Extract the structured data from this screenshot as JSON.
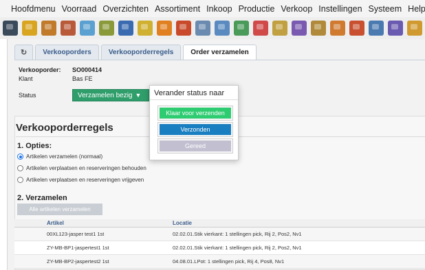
{
  "menu": {
    "home_icon": "home-icon",
    "items": [
      "Hoofdmenu",
      "Voorraad",
      "Overzichten",
      "Assortiment",
      "Inkoop",
      "Productie",
      "Verkoop",
      "Instellingen",
      "Systeem",
      "Help"
    ]
  },
  "toolbar": {
    "icons": [
      {
        "name": "device-icon",
        "color": "#3a4a5a"
      },
      {
        "name": "folder-icon",
        "color": "#d9a520"
      },
      {
        "name": "tools-icon",
        "color": "#c07a2a"
      },
      {
        "name": "wrench-icon",
        "color": "#b85a3a"
      },
      {
        "name": "box-icon",
        "color": "#5aa0d0"
      },
      {
        "name": "grid-icon",
        "color": "#8a9a3a"
      },
      {
        "name": "sphere-icon",
        "color": "#3a6ab0"
      },
      {
        "name": "bowl-icon",
        "color": "#d0b030"
      },
      {
        "name": "gem-icon",
        "color": "#e08020"
      },
      {
        "name": "puzzle-icon",
        "color": "#c84a2a"
      },
      {
        "name": "search-icon",
        "color": "#6a8ab0"
      },
      {
        "name": "magnifier-icon",
        "color": "#5a8ac0"
      },
      {
        "name": "globe-icon",
        "color": "#4a9a5a"
      },
      {
        "name": "pencil-icon",
        "color": "#d04a4a"
      },
      {
        "name": "clipboard-icon",
        "color": "#c0a040"
      },
      {
        "name": "package-icon",
        "color": "#7a5ab0"
      },
      {
        "name": "notepad-icon",
        "color": "#b08a3a"
      },
      {
        "name": "user-icon",
        "color": "#d07a30"
      },
      {
        "name": "note-icon",
        "color": "#c85030"
      },
      {
        "name": "cube-icon",
        "color": "#4a7ab0"
      },
      {
        "name": "chart-icon",
        "color": "#6a5ab0"
      },
      {
        "name": "parcel-icon",
        "color": "#d09a30"
      }
    ]
  },
  "tabs": {
    "refresh_icon": "↻",
    "items": [
      "Verkooporders",
      "Verkooporderregels",
      "Order verzamelen"
    ]
  },
  "order": {
    "order_label": "Verkooporder:",
    "order_value": "SO000414",
    "client_label": "Klant",
    "client_value": "Bas FE",
    "status_label": "Status",
    "status_value": "Verzamelen bezig",
    "status_color": "#2f9e6b"
  },
  "section": {
    "title": "Verkooporderregels",
    "options_heading": "1. Opties:",
    "options": [
      {
        "label": "Artikelen verzamelen (normaal)",
        "selected": true
      },
      {
        "label": "Artikelen verplaatsen en reserveringen behouden",
        "selected": false
      },
      {
        "label": "Artikelen verplaatsen en reserveringen vrijgeven",
        "selected": false
      }
    ],
    "collect_heading": "2. Verzamelen",
    "collect_all_button": "Alle artikelen verzamelen"
  },
  "table": {
    "headers": [
      "Artikel",
      "Locatie"
    ],
    "rows": [
      [
        "00XL123-jasper test1 1st",
        "02.02.01.Stik vierkant: 1 stellingen pick, Rij 2, Pos2, Nv1"
      ],
      [
        "ZY-MB-BP1-jaspertest1 1st",
        "02.02.01.Stik vierkant: 1 stellingen pick, Rij 2, Pos2, Nv1"
      ],
      [
        "ZY-MB-BP2-jaspertest2 1st",
        "04.08.01.LPot: 1 stellingen pick, Rij 4, Pos8, Nv1"
      ]
    ]
  },
  "popup": {
    "title": "Verander status naar",
    "buttons": [
      {
        "label": "Klaar voor verzenden",
        "color": "#2ecc71",
        "enabled": true
      },
      {
        "label": "Verzonden",
        "color": "#1a7fc0",
        "enabled": true
      },
      {
        "label": "Gereed",
        "color": "#c2bfd0",
        "enabled": false
      }
    ]
  }
}
